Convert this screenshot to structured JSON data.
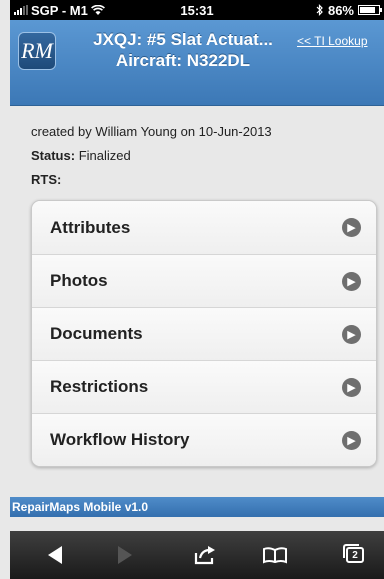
{
  "status_bar": {
    "carrier": "SGP - M1",
    "time": "15:31",
    "battery": "86%"
  },
  "header": {
    "logo_text": "RM",
    "title_line1": "JXQJ: #5 Slat Actuat...",
    "title_line2": "Aircraft: N322DL",
    "ti_lookup_link": "<< TI Lookup"
  },
  "meta": {
    "created_by": "created by William Young on 10-Jun-2013",
    "status_label": "Status:",
    "status_value": "Finalized",
    "rts_label": "RTS:",
    "rts_value": ""
  },
  "menu": {
    "items": [
      {
        "label": "Attributes"
      },
      {
        "label": "Photos"
      },
      {
        "label": "Documents"
      },
      {
        "label": "Restrictions"
      },
      {
        "label": "Workflow History"
      }
    ]
  },
  "footer": {
    "version": "RepairMaps Mobile v1.0"
  },
  "toolbar": {
    "tab_count": "2"
  },
  "icons": {
    "back": "back-arrow-icon",
    "forward": "forward-arrow-icon",
    "share": "share-icon",
    "bookmarks": "bookmarks-icon",
    "tabs": "tabs-icon",
    "row_arrow": "chevron-right-icon"
  },
  "colors": {
    "header_blue": "#4a88c7",
    "footer_blue": "#3f7cbd"
  }
}
